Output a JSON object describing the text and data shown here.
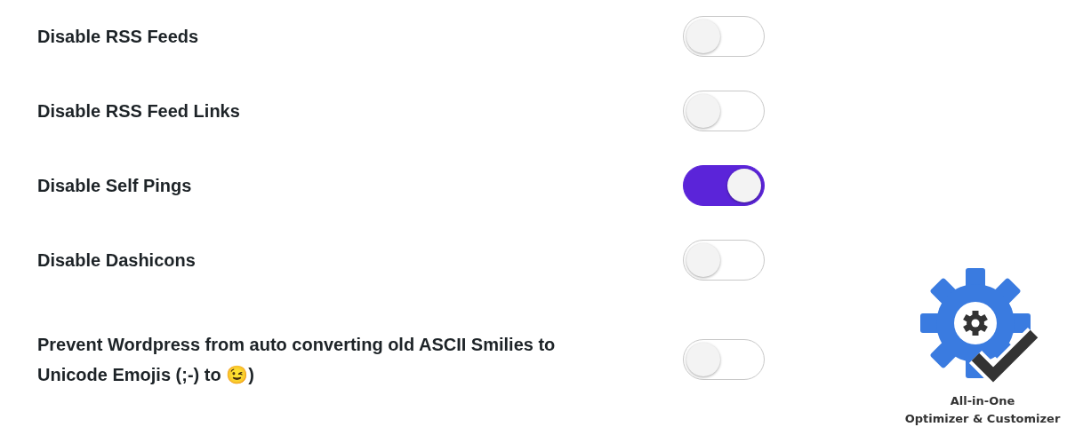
{
  "settings": [
    {
      "label": "Disable RSS Feeds",
      "on": false
    },
    {
      "label": "Disable RSS Feed Links",
      "on": false
    },
    {
      "label": "Disable Self Pings",
      "on": true
    },
    {
      "label": "Disable Dashicons",
      "on": false
    },
    {
      "label": "Prevent Wordpress from auto converting old ASCII Smilies to Unicode Emojis (;-) to 😉)",
      "on": false
    }
  ],
  "logo": {
    "lines": [
      "All-in-One",
      "Optimizer & Customizer"
    ]
  }
}
